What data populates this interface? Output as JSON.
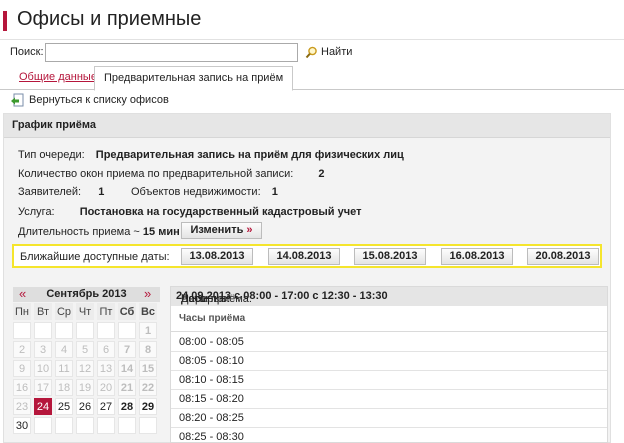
{
  "header": {
    "title": "Офисы и приемные"
  },
  "search": {
    "label": "Поиск:",
    "value": "",
    "button": "Найти"
  },
  "tabs": [
    {
      "label": "Общие данные"
    },
    {
      "label": "Предварительная запись на приём"
    }
  ],
  "back_link": "Вернуться к списку офисов",
  "panel": {
    "title": "График приёма",
    "queue_type_label": "Тип очереди:",
    "queue_type_value": "Предварительная запись на приём для физических лиц",
    "windows_label": "Количество окон приема по предварительной записи:",
    "windows_value": "2",
    "applicants_label": "Заявителей:",
    "applicants_value": "1",
    "objects_label": "Объектов недвижимости:",
    "objects_value": "1",
    "service_label": "Услуга:",
    "service_value": "Постановка на государственный кадастровый учет",
    "duration_label": "Длительность приема ~",
    "duration_value": "15 мин",
    "change_button": "Изменить",
    "change_arrow": "»"
  },
  "nearest_dates": {
    "label": "Ближайшие доступные даты:",
    "dates": [
      "13.08.2013",
      "14.08.2013",
      "15.08.2013",
      "16.08.2013",
      "20.08.2013"
    ]
  },
  "calendar": {
    "prev": "«",
    "next": "»",
    "month": "Сентябрь 2013",
    "weekdays": [
      "Пн",
      "Вт",
      "Ср",
      "Чт",
      "Пт",
      "Сб",
      "Вс"
    ],
    "rows": [
      [
        "",
        "",
        "",
        "",
        "",
        "",
        "1"
      ],
      [
        "2",
        "3",
        "4",
        "5",
        "6",
        "7",
        "8"
      ],
      [
        "9",
        "10",
        "11",
        "12",
        "13",
        "14",
        "15"
      ],
      [
        "16",
        "17",
        "18",
        "19",
        "20",
        "21",
        "22"
      ],
      [
        "23",
        "24",
        "25",
        "26",
        "27",
        "28",
        "29"
      ],
      [
        "30",
        "",
        "",
        "",
        "",
        "",
        ""
      ]
    ],
    "selected_day": "24"
  },
  "schedule": {
    "date_label": "Дата:",
    "date_value": "24.09.2013",
    "hours_label": "Часы приёма:",
    "hours_value": "с 08:00 - 17:00",
    "break_label": "Перерыв:",
    "break_value": "с 12:30 - 13:30",
    "column_title": "Часы приёма",
    "slots": [
      "08:00 - 08:05",
      "08:05 - 08:10",
      "08:10 - 08:15",
      "08:15 - 08:20",
      "08:20 - 08:25",
      "08:25 - 08:30"
    ]
  },
  "colors": {
    "accent": "#b5163b",
    "highlight": "#f5e52c"
  },
  "icons": {
    "search": "magnifier-icon",
    "back": "arrow-back-icon"
  }
}
